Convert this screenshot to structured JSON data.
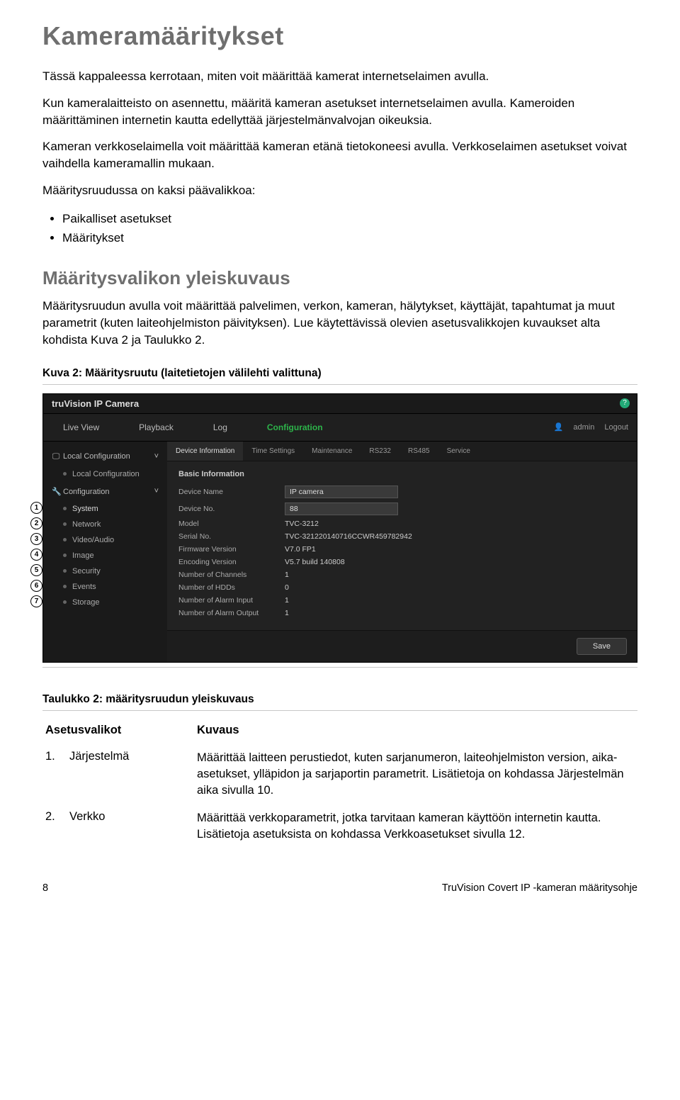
{
  "heading": "Kameramääritykset",
  "intro": {
    "p1": "Tässä kappaleessa kerrotaan, miten voit määrittää kamerat internetselaimen avulla.",
    "p2": "Kun kameralaitteisto on asennettu, määritä kameran asetukset internetselaimen avulla. Kameroiden määrittäminen internetin kautta edellyttää järjestelmänvalvojan oikeuksia.",
    "p3": "Kameran verkkoselaimella voit määrittää kameran etänä tietokoneesi avulla. Verkkoselaimen asetukset voivat vaihdella kameramallin mukaan.",
    "p4": "Määritysruudussa on kaksi päävalikkoa:"
  },
  "menu_bullets": [
    "Paikalliset asetukset",
    "Määritykset"
  ],
  "section2": {
    "title": "Määritysvalikon yleiskuvaus",
    "p1": "Määritysruudun avulla voit määrittää palvelimen, verkon, kameran, hälytykset, käyttäjät, tapahtumat ja muut parametrit (kuten laiteohjelmiston päivityksen). Lue käytettävissä olevien asetusvalikkojen kuvaukset alta kohdista Kuva 2 ja Taulukko 2."
  },
  "figure_caption": "Kuva 2: Määritysruutu (laitetietojen välilehti valittuna)",
  "app": {
    "brand": "truVision IP Camera",
    "nav": {
      "live": "Live View",
      "playback": "Playback",
      "log": "Log",
      "config": "Configuration",
      "user": "admin",
      "logout": "Logout"
    },
    "sidebar": {
      "local_section": "Local Configuration",
      "local_item": "Local Configuration",
      "config_section": "Configuration",
      "items": [
        "System",
        "Network",
        "Video/Audio",
        "Image",
        "Security",
        "Events",
        "Storage"
      ]
    },
    "tabs": [
      "Device Information",
      "Time Settings",
      "Maintenance",
      "RS232",
      "RS485",
      "Service"
    ],
    "panel_title": "Basic Information",
    "fields": {
      "device_name": {
        "label": "Device Name",
        "value": "IP camera"
      },
      "device_no": {
        "label": "Device No.",
        "value": "88"
      },
      "model": {
        "label": "Model",
        "value": "TVC-3212"
      },
      "serial": {
        "label": "Serial No.",
        "value": "TVC-321220140716CCWR459782942"
      },
      "fw": {
        "label": "Firmware Version",
        "value": "V7.0 FP1"
      },
      "enc": {
        "label": "Encoding Version",
        "value": "V5.7 build 140808"
      },
      "channels": {
        "label": "Number of Channels",
        "value": "1"
      },
      "hdds": {
        "label": "Number of HDDs",
        "value": "0"
      },
      "alarm_in": {
        "label": "Number of Alarm Input",
        "value": "1"
      },
      "alarm_out": {
        "label": "Number of Alarm Output",
        "value": "1"
      }
    },
    "save": "Save"
  },
  "table_caption": "Taulukko 2: määritysruudun yleiskuvaus",
  "table": {
    "col1": "Asetusvalikot",
    "col2": "Kuvaus",
    "rows": [
      {
        "num": "1.",
        "key": "Järjestelmä",
        "desc": "Määrittää laitteen perustiedot, kuten sarjanumeron, laiteohjelmiston version, aika-asetukset, ylläpidon ja sarjaportin parametrit. Lisätietoja on kohdassa Järjestelmän aika sivulla 10."
      },
      {
        "num": "2.",
        "key": "Verkko",
        "desc": "Määrittää verkkoparametrit, jotka tarvitaan kameran käyttöön internetin kautta. Lisätietoja asetuksista on kohdassa Verkkoasetukset sivulla 12."
      }
    ]
  },
  "footer": {
    "page": "8",
    "doc": "TruVision Covert IP -kameran määritysohje"
  }
}
